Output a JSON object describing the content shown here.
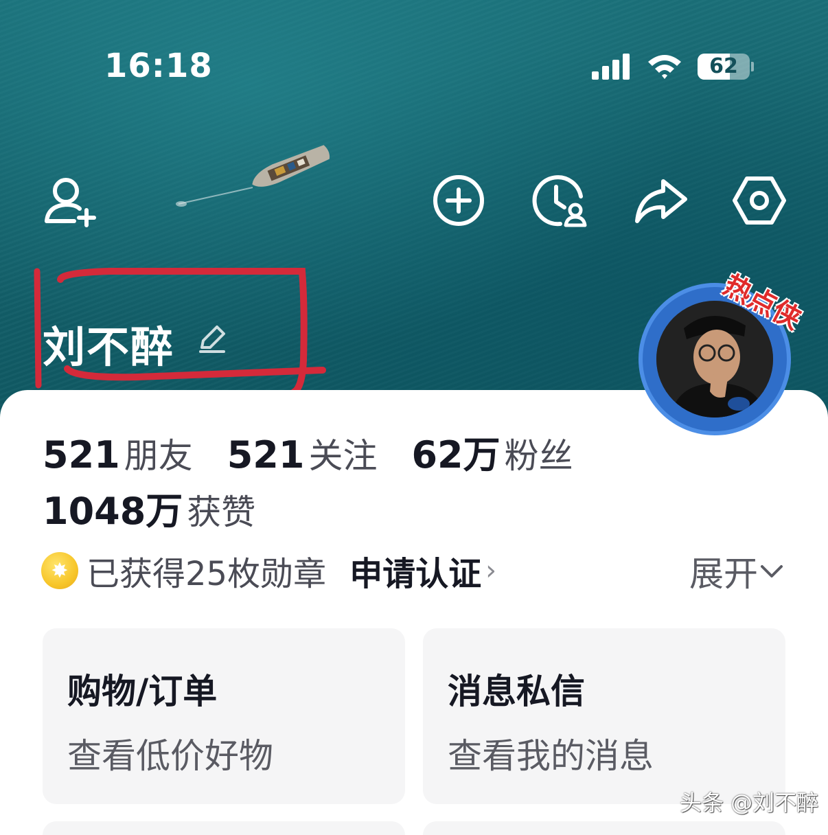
{
  "status_bar": {
    "time": "16:18",
    "battery_level": "62",
    "battery_fraction": 0.62,
    "icons": [
      "signal-icon",
      "wifi-icon",
      "battery-icon"
    ]
  },
  "header_actions": {
    "left": "add-friend-icon",
    "right": [
      "add-circle-icon",
      "visitor-history-icon",
      "share-icon",
      "settings-icon"
    ]
  },
  "profile": {
    "name": "刘不醉",
    "avatar_badge": "热点侠",
    "annotation_color": "#d42a3a"
  },
  "stats": {
    "friends": {
      "value": "521",
      "label": "朋友"
    },
    "following": {
      "value": "521",
      "label": "关注"
    },
    "followers": {
      "value": "62万",
      "label": "粉丝"
    },
    "likes": {
      "value": "1048万",
      "label": "获赞"
    }
  },
  "badges": {
    "text": "已获得25枚勋章",
    "verify": "申请认证",
    "verify_chevron": "›",
    "expand": "展开"
  },
  "cards": [
    {
      "title": "购物/订单",
      "subtitle": "查看低价好物"
    },
    {
      "title": "消息私信",
      "subtitle": "查看我的消息"
    }
  ],
  "watermark": "头条 @刘不醉",
  "colors": {
    "hero_sea": "#14626c",
    "text_primary": "#161823",
    "text_secondary": "#5a5b63",
    "card_bg": "#f5f5f6"
  }
}
